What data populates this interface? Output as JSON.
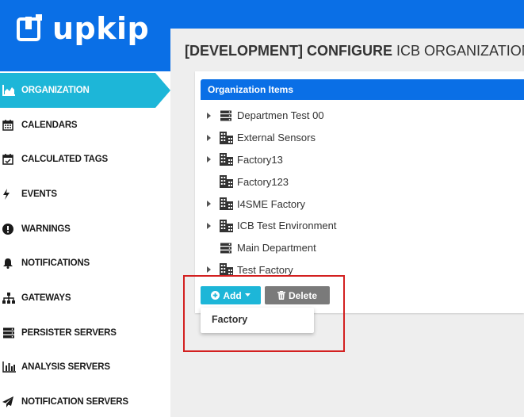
{
  "brand": {
    "name": "upkip"
  },
  "sidebar": {
    "items": [
      {
        "label": "ORGANIZATION",
        "icon": "area-chart-icon",
        "active": true
      },
      {
        "label": "CALENDARS",
        "icon": "calendar-icon"
      },
      {
        "label": "CALCULATED TAGS",
        "icon": "calendar-check-icon"
      },
      {
        "label": "EVENTS",
        "icon": "bolt-icon"
      },
      {
        "label": "WARNINGS",
        "icon": "exclamation-circle-icon"
      },
      {
        "label": "NOTIFICATIONS",
        "icon": "bell-icon"
      },
      {
        "label": "GATEWAYS",
        "icon": "sitemap-icon"
      },
      {
        "label": "PERSISTER SERVERS",
        "icon": "server-icon"
      },
      {
        "label": "ANALYSIS SERVERS",
        "icon": "bar-chart-icon"
      },
      {
        "label": "NOTIFICATION SERVERS",
        "icon": "paper-plane-icon"
      }
    ]
  },
  "page": {
    "title_part1": "[DEVELOPMENT] CONFIGURE",
    "title_part2": " ICB ORGANIZATION"
  },
  "panel": {
    "header": "Organization Items",
    "items": [
      {
        "label": "Departmen Test 00",
        "icon": "server-icon",
        "expandable": true
      },
      {
        "label": "External Sensors",
        "icon": "building-icon",
        "expandable": true
      },
      {
        "label": "Factory13",
        "icon": "building-icon",
        "expandable": true
      },
      {
        "label": "Factory123",
        "icon": "building-icon",
        "expandable": false
      },
      {
        "label": "I4SME Factory",
        "icon": "building-icon",
        "expandable": true
      },
      {
        "label": "ICB Test Environment",
        "icon": "building-icon",
        "expandable": true
      },
      {
        "label": "Main Department",
        "icon": "server-icon",
        "expandable": false
      },
      {
        "label": "Test Factory",
        "icon": "building-icon",
        "expandable": true
      }
    ]
  },
  "actions": {
    "add_label": "Add",
    "delete_label": "Delete",
    "dropdown": [
      "Factory"
    ]
  },
  "colors": {
    "primary": "#0a6fe6",
    "accent": "#1db6d8",
    "delete": "#7a7a7a",
    "highlight": "#d32020"
  }
}
